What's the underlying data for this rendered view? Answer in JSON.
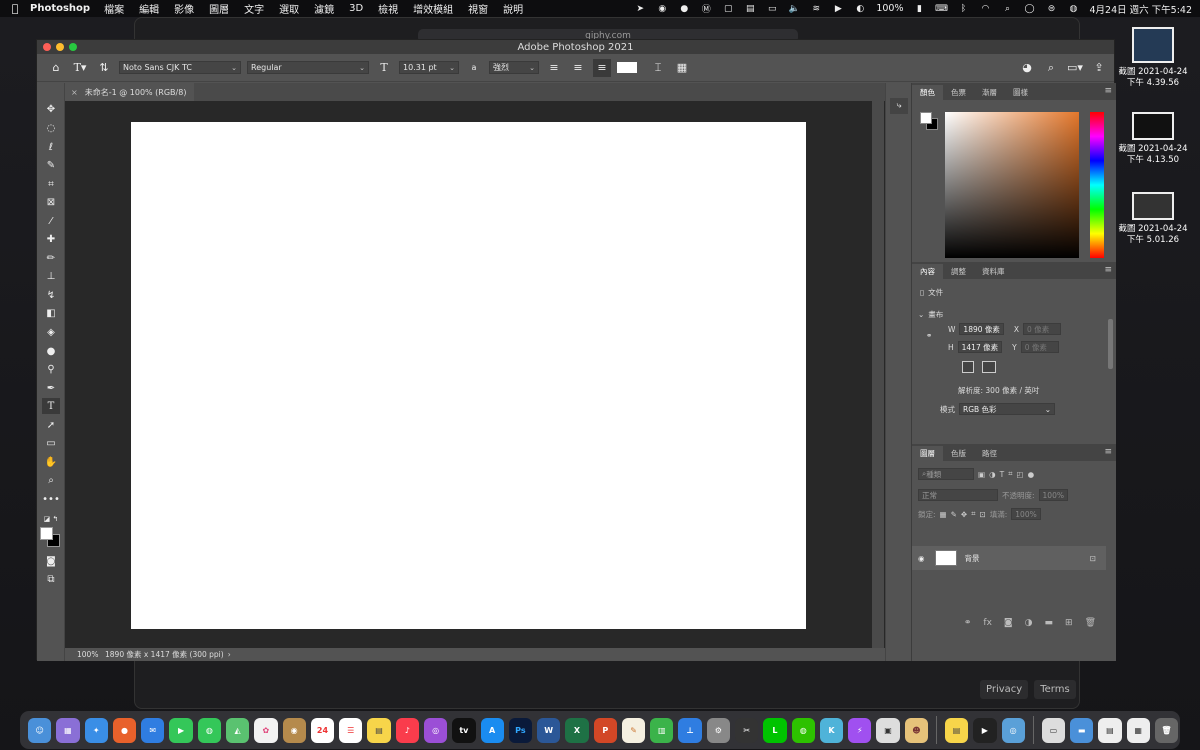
{
  "menubar": {
    "app": "Photoshop",
    "menus": [
      "檔案",
      "編輯",
      "影像",
      "圖層",
      "文字",
      "選取",
      "濾鏡",
      "3D",
      "檢視",
      "增效模組",
      "視窗",
      "說明"
    ],
    "battery": "100%",
    "clock": "4月24日 週六 下午5:42"
  },
  "browser_bg": {
    "url": "giphy.com",
    "privacy": "Privacy",
    "terms": "Terms"
  },
  "desktop_files": [
    {
      "date": "截圖 2021-04-24",
      "time": "下午 4.39.56"
    },
    {
      "date": "截圖 2021-04-24",
      "time": "下午 4.13.50"
    },
    {
      "date": "截圖 2021-04-24",
      "time": "下午 5.01.26"
    }
  ],
  "window": {
    "title": "Adobe Photoshop 2021"
  },
  "options_bar": {
    "font_family": "Noto Sans CJK TC",
    "font_style": "Regular",
    "font_size": "10.31 pt",
    "aa_label": "a",
    "antialias": "強烈"
  },
  "doc_tab": {
    "label": "未命名-1 @ 100% (RGB/8)"
  },
  "status_bar": {
    "zoom": "100%",
    "info": "1890 像素 x 1417 像素 (300 ppi)"
  },
  "color_panel": {
    "tabs": [
      "顏色",
      "色票",
      "漸層",
      "圖樣"
    ],
    "foreground": "#ffffff",
    "background": "#000000",
    "picked_hue": "#e4772b"
  },
  "properties_panel": {
    "tabs": [
      "內容",
      "調整",
      "資料庫"
    ],
    "doc_label": "文件",
    "section": "畫布",
    "w_label": "W",
    "w_value": "1890 像素",
    "h_label": "H",
    "h_value": "1417 像素",
    "x_label": "X",
    "x_placeholder": "0 像素",
    "y_label": "Y",
    "y_placeholder": "0 像素",
    "resolution": "解析度: 300 像素 / 英吋",
    "mode_label": "模式",
    "mode_value": "RGB 色彩"
  },
  "layers_panel": {
    "tabs": [
      "圖層",
      "色版",
      "路徑"
    ],
    "filter_placeholder": "種類",
    "blend_mode": "正常",
    "opacity_label": "不透明度:",
    "opacity": "100%",
    "lock_label": "鎖定:",
    "fill_label": "填滿:",
    "fill": "100%",
    "layer_name": "背景"
  },
  "dock": {
    "calendar_day": "24",
    "ps_label": "Ps",
    "word_label": "W",
    "excel_label": "X",
    "ppt_label": "P",
    "tv_label": "tv"
  }
}
